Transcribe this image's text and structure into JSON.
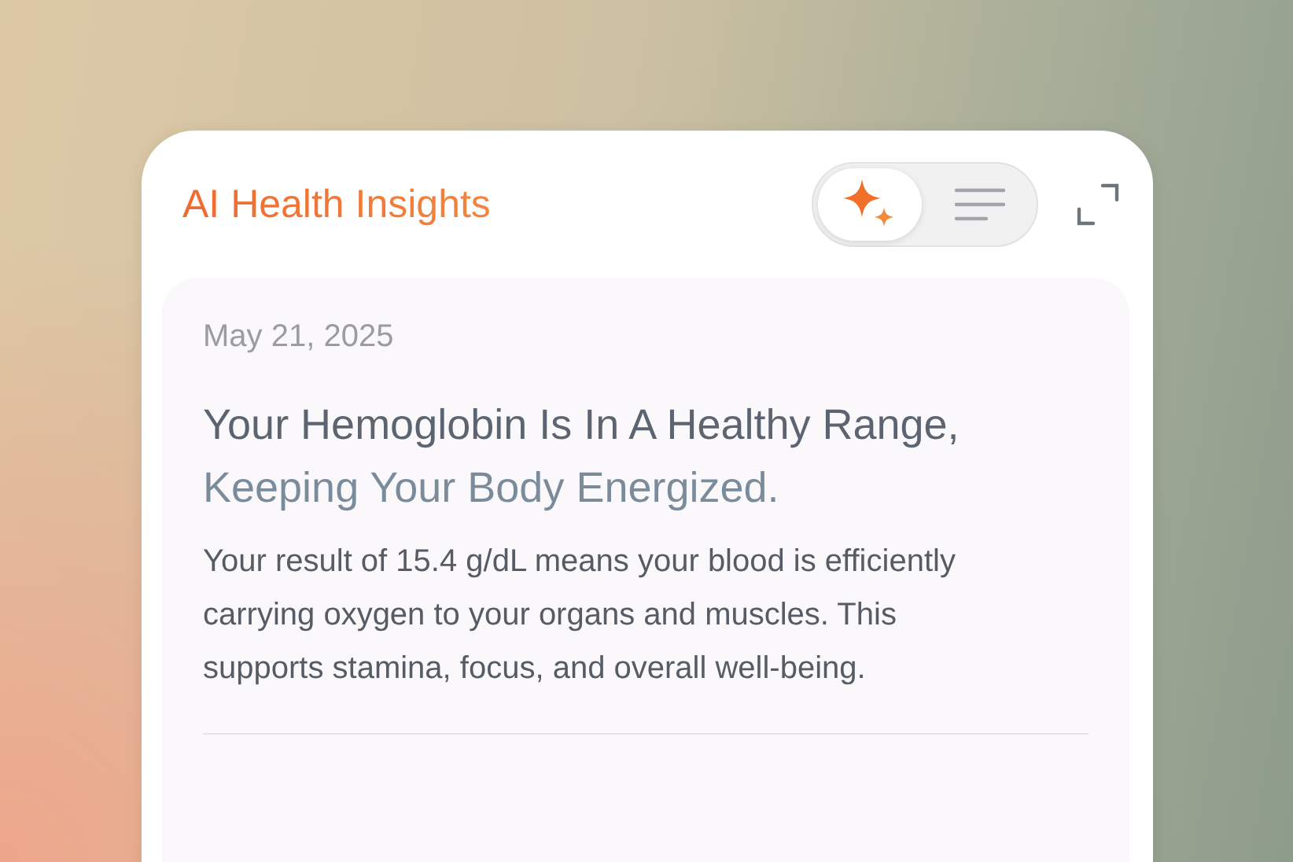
{
  "title": "AI Health Insights",
  "view_toggle": [
    {
      "kind": "insights",
      "selected": true
    },
    {
      "kind": "list",
      "selected": false
    }
  ],
  "insight": {
    "date": "May 21, 2025",
    "headline": "Your Hemoglobin Is In A Healthy Range, Keeping Your Body Energized.",
    "body": "Your result of 15.4 g/dL means your blood is efficiently carrying oxygen to your organs and muscles. This supports stamina, focus, and overall well-being."
  }
}
